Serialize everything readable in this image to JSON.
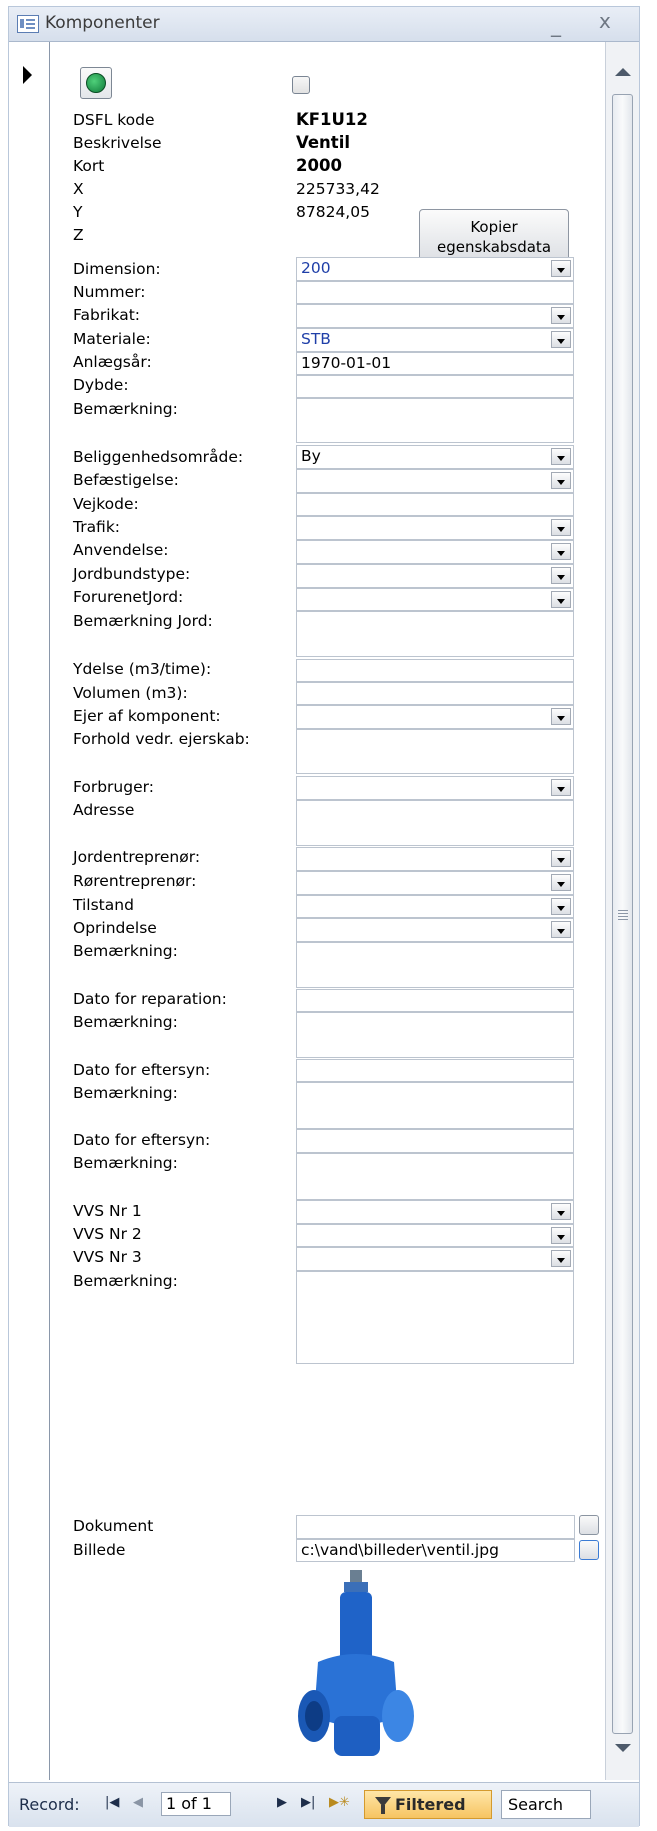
{
  "window": {
    "title": "Komponenter",
    "minimize_glyph": "_",
    "close_glyph": "x"
  },
  "header": {
    "dsfl_label": "DSFL kode",
    "dsfl_value": "KF1U12",
    "beskrivelse_label": "Beskrivelse",
    "beskrivelse_value": "Ventil",
    "kort_label": "Kort",
    "kort_value": "2000",
    "x_label": "X",
    "x_value": "225733,42",
    "y_label": "Y",
    "y_value": "87824,05",
    "z_label": "Z",
    "copy_button": {
      "line1": "Kopier",
      "line2": "egenskabsdata"
    }
  },
  "fields": {
    "dimension": {
      "label": "Dimension:",
      "value": "200"
    },
    "nummer": {
      "label": "Nummer:",
      "value": ""
    },
    "fabrikat": {
      "label": "Fabrikat:",
      "value": ""
    },
    "materiale": {
      "label": "Materiale:",
      "value": "STB"
    },
    "anlaegsaar": {
      "label": "Anlægsår:",
      "value": "1970-01-01"
    },
    "dybde": {
      "label": "Dybde:",
      "value": ""
    },
    "bemaerkning1": {
      "label": "Bemærkning:",
      "value": ""
    },
    "beliggenhed": {
      "label": "Beliggenhedsområde:",
      "value": "By"
    },
    "befaestigelse": {
      "label": "Befæstigelse:",
      "value": ""
    },
    "vejkode": {
      "label": "Vejkode:",
      "value": ""
    },
    "trafik": {
      "label": "Trafik:",
      "value": ""
    },
    "anvendelse": {
      "label": "Anvendelse:",
      "value": ""
    },
    "jordbundstype": {
      "label": "Jordbundstype:",
      "value": ""
    },
    "forurenetjord": {
      "label": "ForurenetJord:",
      "value": ""
    },
    "bemaerkning_jord": {
      "label": "Bemærkning Jord:",
      "value": ""
    },
    "ydelse": {
      "label": "Ydelse (m3/time):",
      "value": ""
    },
    "volumen": {
      "label": "Volumen (m3):",
      "value": ""
    },
    "ejer": {
      "label": "Ejer af komponent:",
      "value": ""
    },
    "forhold": {
      "label": "Forhold vedr. ejerskab:",
      "value": ""
    },
    "forbruger": {
      "label": "Forbruger:",
      "value": ""
    },
    "adresse": {
      "label": "Adresse",
      "value": ""
    },
    "jordentreprenor": {
      "label": "Jordentreprenør:",
      "value": ""
    },
    "rorentreprenor": {
      "label": "Rørentreprenør:",
      "value": ""
    },
    "tilstand": {
      "label": "Tilstand",
      "value": ""
    },
    "oprindelse": {
      "label": "Oprindelse",
      "value": ""
    },
    "bemaerkning2": {
      "label": "Bemærkning:",
      "value": ""
    },
    "dato_reparation": {
      "label": "Dato for reparation:",
      "value": ""
    },
    "bemaerkning3": {
      "label": "Bemærkning:",
      "value": ""
    },
    "dato_eftersyn1": {
      "label": "Dato for eftersyn:",
      "value": ""
    },
    "bemaerkning4": {
      "label": "Bemærkning:",
      "value": ""
    },
    "dato_eftersyn2": {
      "label": "Dato for eftersyn:",
      "value": ""
    },
    "bemaerkning5": {
      "label": "Bemærkning:",
      "value": ""
    },
    "vvs1": {
      "label": "VVS Nr 1",
      "value": ""
    },
    "vvs2": {
      "label": "VVS Nr 2",
      "value": ""
    },
    "vvs3": {
      "label": "VVS Nr 3",
      "value": ""
    },
    "bemaerkning6": {
      "label": "Bemærkning:",
      "value": ""
    },
    "dokument": {
      "label": "Dokument",
      "value": ""
    },
    "billede": {
      "label": "Billede",
      "value": "c:\\vand\\billeder\\ventil.jpg"
    }
  },
  "navbar": {
    "record_label": "Record:",
    "record_value": "1 of 1",
    "filtered_label": "Filtered",
    "search_label": "Search"
  },
  "colors": {
    "value_blue": "#1f3fa8",
    "filtered_bg": "#f6c462",
    "valve_blue": "#1f63c8"
  }
}
